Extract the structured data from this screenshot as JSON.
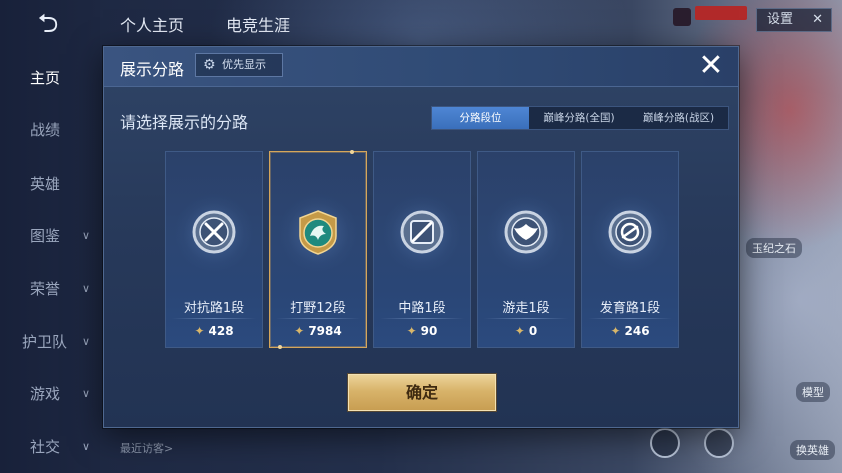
{
  "background": {
    "top_tabs": [
      "个人主页",
      "电竞生涯"
    ],
    "settings_button": "设置",
    "sidebar": [
      {
        "label": "主页",
        "active": true,
        "chevron": false
      },
      {
        "label": "战绩",
        "active": false,
        "chevron": false
      },
      {
        "label": "英雄",
        "active": false,
        "chevron": false
      },
      {
        "label": "图鉴",
        "active": false,
        "chevron": true
      },
      {
        "label": "荣誉",
        "active": false,
        "chevron": true
      },
      {
        "label": "护卫队",
        "active": false,
        "chevron": true
      },
      {
        "label": "游戏",
        "active": false,
        "chevron": true
      },
      {
        "label": "社交",
        "active": false,
        "chevron": true
      }
    ],
    "recent_visitors": "最近访客>",
    "right_labels": [
      "玉纪之石",
      "模型",
      "换英雄"
    ]
  },
  "modal": {
    "title": "展示分路",
    "priority_button": "优先显示",
    "close_icon": "close-icon",
    "subtitle": "请选择展示的分路",
    "segments": [
      {
        "label": "分路段位",
        "active": true
      },
      {
        "label": "巅峰分路(全国)",
        "active": false
      },
      {
        "label": "巅峰分路(战区)",
        "active": false
      }
    ],
    "cards": [
      {
        "label": "对抗路1段",
        "points": "428",
        "emblem": "swords-emblem-icon",
        "selected": false
      },
      {
        "label": "打野12段",
        "points": "7984",
        "emblem": "dragon-emblem-icon",
        "selected": true
      },
      {
        "label": "中路1段",
        "points": "90",
        "emblem": "mid-lane-emblem-icon",
        "selected": false
      },
      {
        "label": "游走1段",
        "points": "0",
        "emblem": "wings-emblem-icon",
        "selected": false
      },
      {
        "label": "发育路1段",
        "points": "246",
        "emblem": "target-emblem-icon",
        "selected": false
      }
    ],
    "confirm_button": "确定"
  },
  "colors": {
    "modal_bg": "#2b416a",
    "accent_blue": "#4e86d4",
    "gold": "#d8b36a",
    "selected_border": "#d6a65a"
  }
}
